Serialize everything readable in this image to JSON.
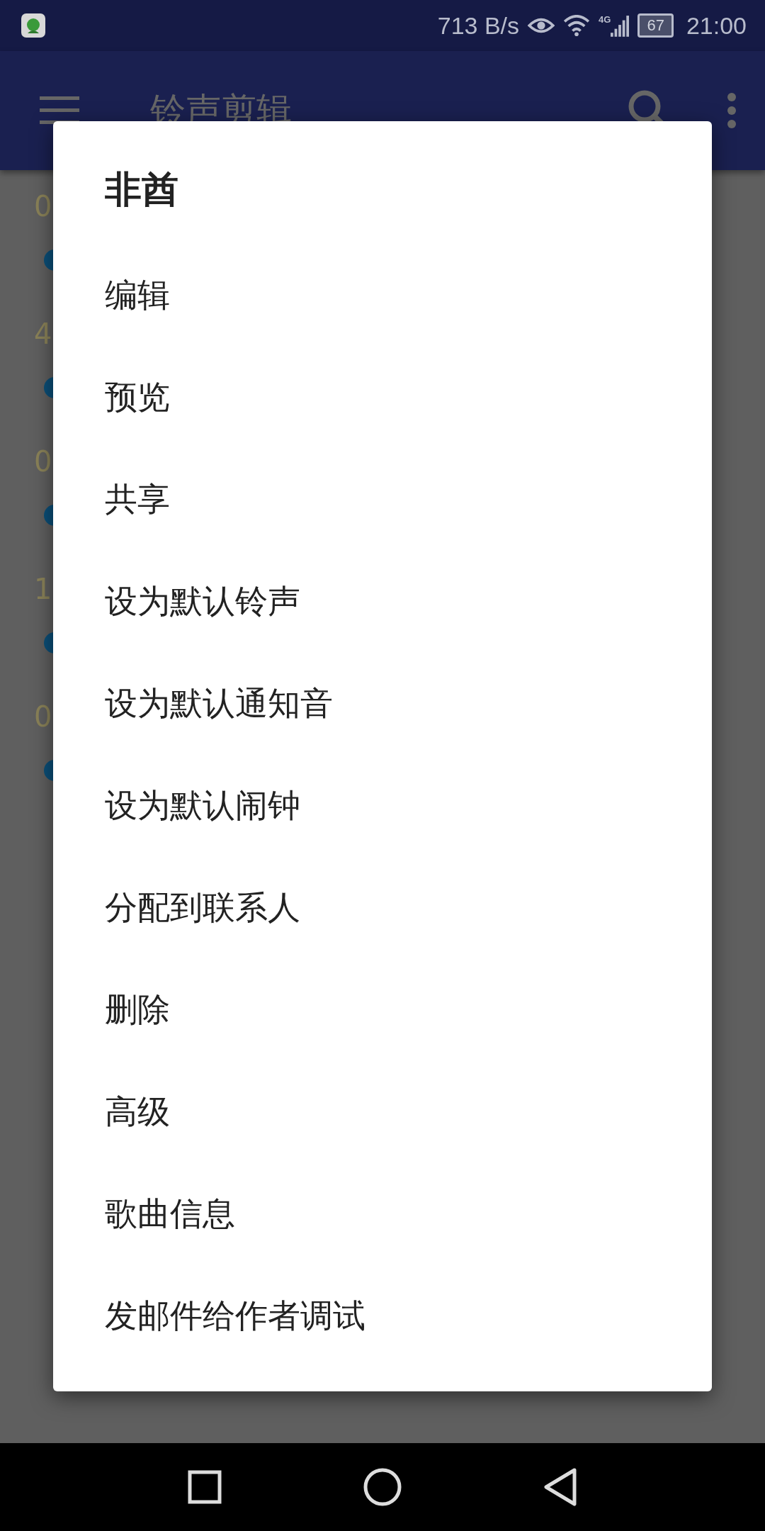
{
  "status_bar": {
    "speed": "713 B/s",
    "network": "4G",
    "battery": "67",
    "time": "21:00"
  },
  "app_bar": {
    "title": "铃声剪辑"
  },
  "list_rows": [
    {
      "label": "0"
    },
    {
      "label": "4"
    },
    {
      "label": "0"
    },
    {
      "label": "1"
    },
    {
      "label": "0"
    }
  ],
  "dialog": {
    "title": "非酋",
    "items": [
      "编辑",
      "预览",
      "共享",
      "设为默认铃声",
      "设为默认通知音",
      "设为默认闹钟",
      "分配到联系人",
      "删除",
      "高级",
      "歌曲信息",
      "发邮件给作者调试"
    ]
  }
}
